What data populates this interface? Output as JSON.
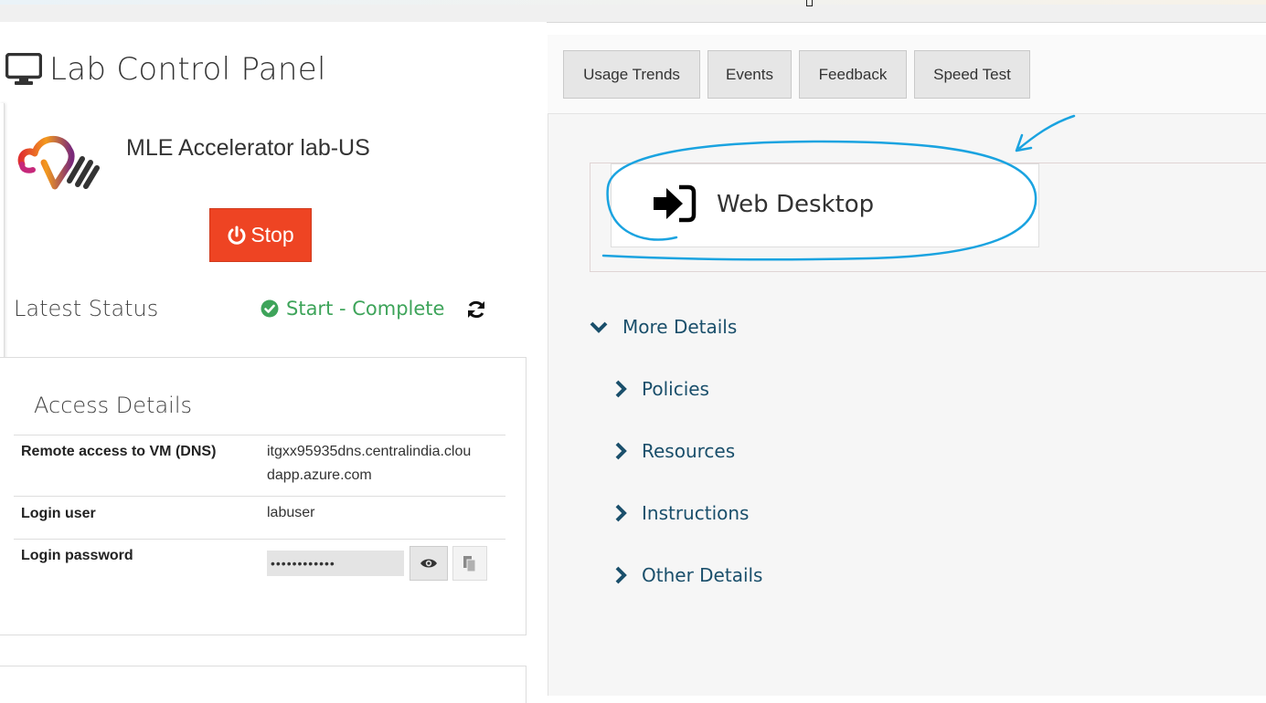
{
  "panel": {
    "title": "Lab Control Panel",
    "lab_name": "MLE Accelerator lab-US",
    "stop_label": "Stop",
    "status_label": "Latest Status",
    "status_value": "Start - Complete",
    "status_color": "#3ea45a",
    "stop_color": "#ee4423"
  },
  "access": {
    "title": "Access Details",
    "rows": [
      {
        "label": "Remote access to VM (DNS)",
        "value_line1": "itgxx95935dns.centralindia.clou",
        "value_line2": "dapp.azure.com"
      },
      {
        "label": "Login user",
        "value": "labuser"
      },
      {
        "label": "Login password",
        "value": "••••••••••••"
      }
    ]
  },
  "tabs": [
    "Usage Trends",
    "Events",
    "Feedback",
    "Speed Test"
  ],
  "web_desktop": {
    "label": "Web Desktop",
    "icon": "sign-in-icon"
  },
  "details": {
    "more": "More Details",
    "items": [
      "Policies",
      "Resources",
      "Instructions",
      "Other Details"
    ],
    "color": "#1a4f6b"
  },
  "annotation_color": "#1aa3e0"
}
